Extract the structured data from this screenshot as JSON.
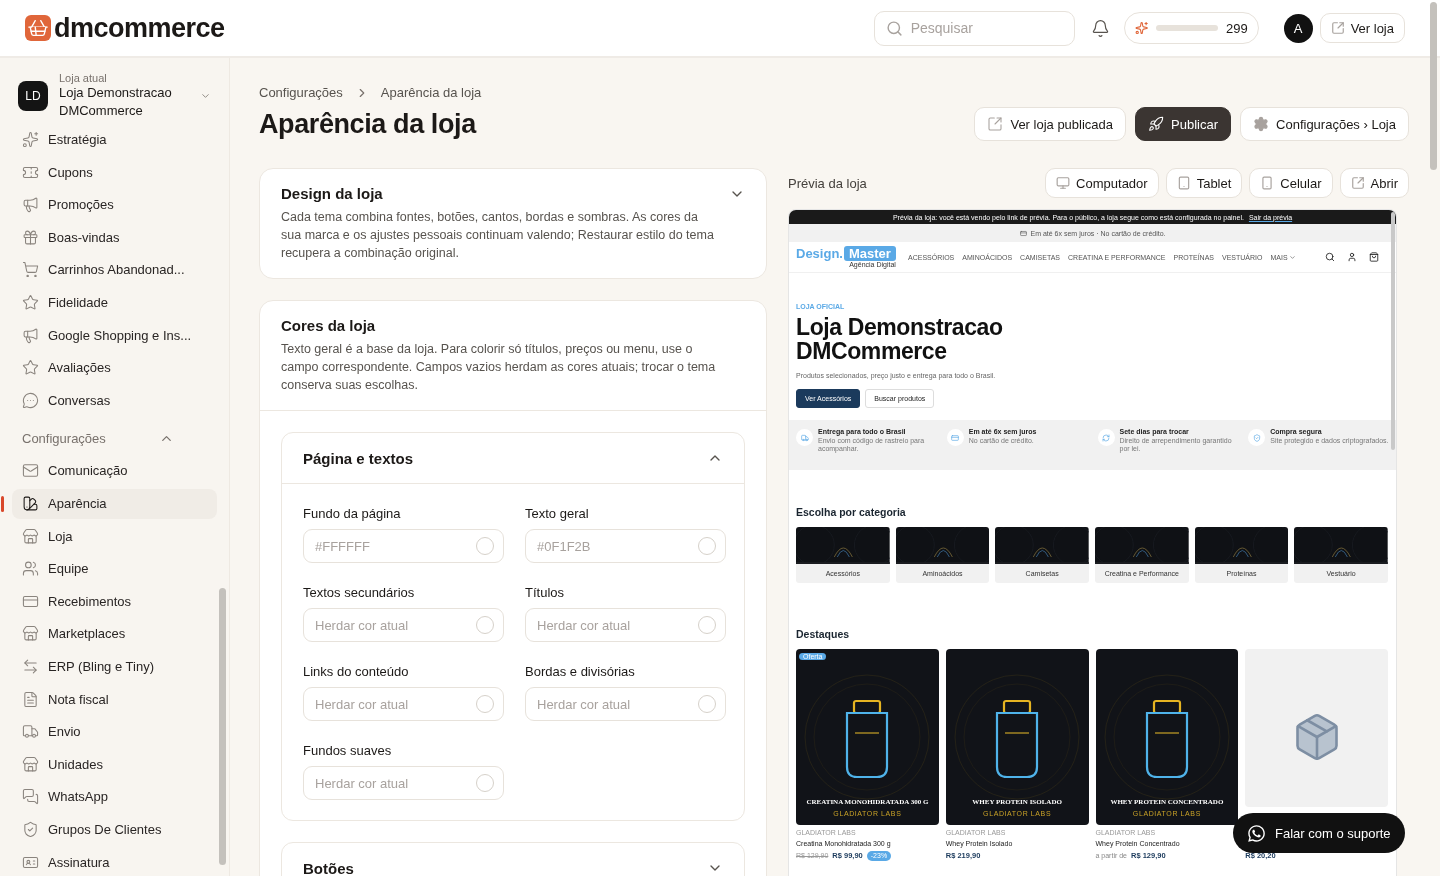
{
  "header": {
    "logo": "dmcommerce",
    "search": {
      "placeholder": "Pesquisar"
    },
    "credits": {
      "count": "299"
    },
    "avatar": "A",
    "store_button": "Ver loja"
  },
  "sidebar": {
    "store": {
      "initials": "LD",
      "caption": "Loja atual",
      "name": "Loja Demonstracao DMCommerce"
    },
    "items": [
      {
        "label": "Estratégia",
        "selected": false
      },
      {
        "label": "Cupons",
        "selected": false
      },
      {
        "label": "Promoções",
        "selected": false
      },
      {
        "label": "Boas-vindas",
        "selected": false
      },
      {
        "label": "Carrinhos Abandonad...",
        "selected": false
      },
      {
        "label": "Fidelidade",
        "selected": false
      },
      {
        "label": "Google Shopping e Ins...",
        "selected": false
      },
      {
        "label": "Avaliações",
        "selected": false
      },
      {
        "label": "Conversas",
        "selected": false
      }
    ],
    "section": {
      "title": "Configurações",
      "expanded": true,
      "items": [
        {
          "label": "Comunicação",
          "selected": false
        },
        {
          "label": "Aparência",
          "selected": true
        },
        {
          "label": "Loja",
          "selected": false
        },
        {
          "label": "Equipe",
          "selected": false
        },
        {
          "label": "Recebimentos",
          "selected": false
        },
        {
          "label": "Marketplaces",
          "selected": false
        },
        {
          "label": "ERP (Bling e Tiny)",
          "selected": false
        },
        {
          "label": "Nota fiscal",
          "selected": false
        },
        {
          "label": "Envio",
          "selected": false
        },
        {
          "label": "Unidades",
          "selected": false
        },
        {
          "label": "WhatsApp",
          "selected": false
        },
        {
          "label": "Grupos De Clientes",
          "selected": false
        },
        {
          "label": "Assinatura",
          "selected": false
        }
      ]
    }
  },
  "breadcrumb": [
    "Configurações",
    "Aparência da loja"
  ],
  "page_title": "Aparência da loja",
  "actions": [
    {
      "label": "Ver loja publicada",
      "kind": "external"
    },
    {
      "label": "Publicar",
      "kind": "primary"
    },
    {
      "label": "Configurações › Loja",
      "kind": "settings"
    }
  ],
  "sections": [
    {
      "title": "Design da loja",
      "description": "Cada tema combina fontes, botões, cantos, bordas e sombras. As cores da sua marca e os ajustes pessoais continuam valendo; Restaurar estilo do tema recupera a combinação original.",
      "expanded": false
    },
    {
      "title": "Cores da loja",
      "description": "Texto geral é a base da loja. Para colorir só títulos, preços ou menu, use o campo correspondente. Campos vazios herdam as cores atuais; trocar o tema conserva suas escolhas.",
      "groups": [
        {
          "title": "Página e textos",
          "expanded": true,
          "fields": [
            {
              "label": "Fundo da página",
              "placeholder": "#FFFFFF"
            },
            {
              "label": "Texto geral",
              "placeholder": "#0F1F2B"
            },
            {
              "label": "Textos secundários",
              "placeholder": "Herdar cor atual"
            },
            {
              "label": "Títulos",
              "placeholder": "Herdar cor atual"
            },
            {
              "label": "Links do conteúdo",
              "placeholder": "Herdar cor atual"
            },
            {
              "label": "Bordas e divisórias",
              "placeholder": "Herdar cor atual"
            },
            {
              "label": "Fundos suaves",
              "placeholder": "Herdar cor atual"
            }
          ]
        },
        {
          "title": "Botões",
          "expanded": false
        }
      ]
    }
  ],
  "preview": {
    "label": "Prévia da loja",
    "devices": [
      "Computador",
      "Tablet",
      "Celular"
    ],
    "open_button": "Abrir",
    "notice": {
      "text": "Prévia da loja: você está vendo pelo link de prévia. Para o público, a loja segue como está configurada no painel.",
      "link": "Sair da prévia"
    },
    "promo_bar": "Em até 6x sem juros · No cartão de crédito.",
    "logo": {
      "primary": "Design.",
      "secondary": "Master",
      "tagline": "Agência Digital"
    },
    "nav": [
      "ACESSÓRIOS",
      "AMINOÁCIDOS",
      "CAMISETAS",
      "CREATINA E PERFORMANCE",
      "PROTEÍNAS",
      "VESTUÁRIO",
      "MAIS"
    ],
    "hero": {
      "eyebrow": "LOJA OFICIAL",
      "title": "Loja Demonstracao DMCommerce",
      "subtitle": "Produtos selecionados, preço justo e entrega para todo o Brasil.",
      "buttons": [
        {
          "label": "Ver Acessórios",
          "kind": "primary"
        },
        {
          "label": "Buscar produtos",
          "kind": "secondary"
        }
      ]
    },
    "features": [
      {
        "title": "Entrega para todo o Brasil",
        "text": "Envio com código de rastreio para acompanhar."
      },
      {
        "title": "Em até 6x sem juros",
        "text": "No cartão de crédito."
      },
      {
        "title": "Sete dias para trocar",
        "text": "Direito de arrependimento garantido por lei."
      },
      {
        "title": "Compra segura",
        "text": "Site protegido e dados criptografados."
      }
    ],
    "categories_title": "Escolha por categoria",
    "categories": [
      "Acessórios",
      "Aminoácidos",
      "Camisetas",
      "Creatina e Performance",
      "Proteínas",
      "Vestuário"
    ],
    "featured_title": "Destaques",
    "products": [
      {
        "kind": "artwork",
        "badge": "Oferta",
        "image_title": "CREATINA MONOHIDRATADA 300 G",
        "image_brand": "GLADIATOR LABS",
        "brand": "GLADIATOR LABS",
        "name": "Creatina Monohidratada 300 g",
        "old_price": "R$ 129,90",
        "price": "R$ 99,90",
        "discount": "-23%"
      },
      {
        "kind": "artwork",
        "image_title": "WHEY PROTEIN ISOLADO",
        "image_brand": "GLADIATOR LABS",
        "brand": "GLADIATOR LABS",
        "name": "Whey Protein Isolado",
        "price": "R$ 219,90"
      },
      {
        "kind": "artwork",
        "image_title": "WHEY PROTEIN CONCENTRADO",
        "image_brand": "GLADIATOR LABS",
        "brand": "GLADIATOR LABS",
        "name": "Whey Protein Concentrado",
        "price_prefix": "a partir de",
        "price": "R$ 129,90"
      },
      {
        "kind": "placeholder",
        "price": "R$ 20,20"
      }
    ]
  },
  "support_button": "Falar com o suporte"
}
